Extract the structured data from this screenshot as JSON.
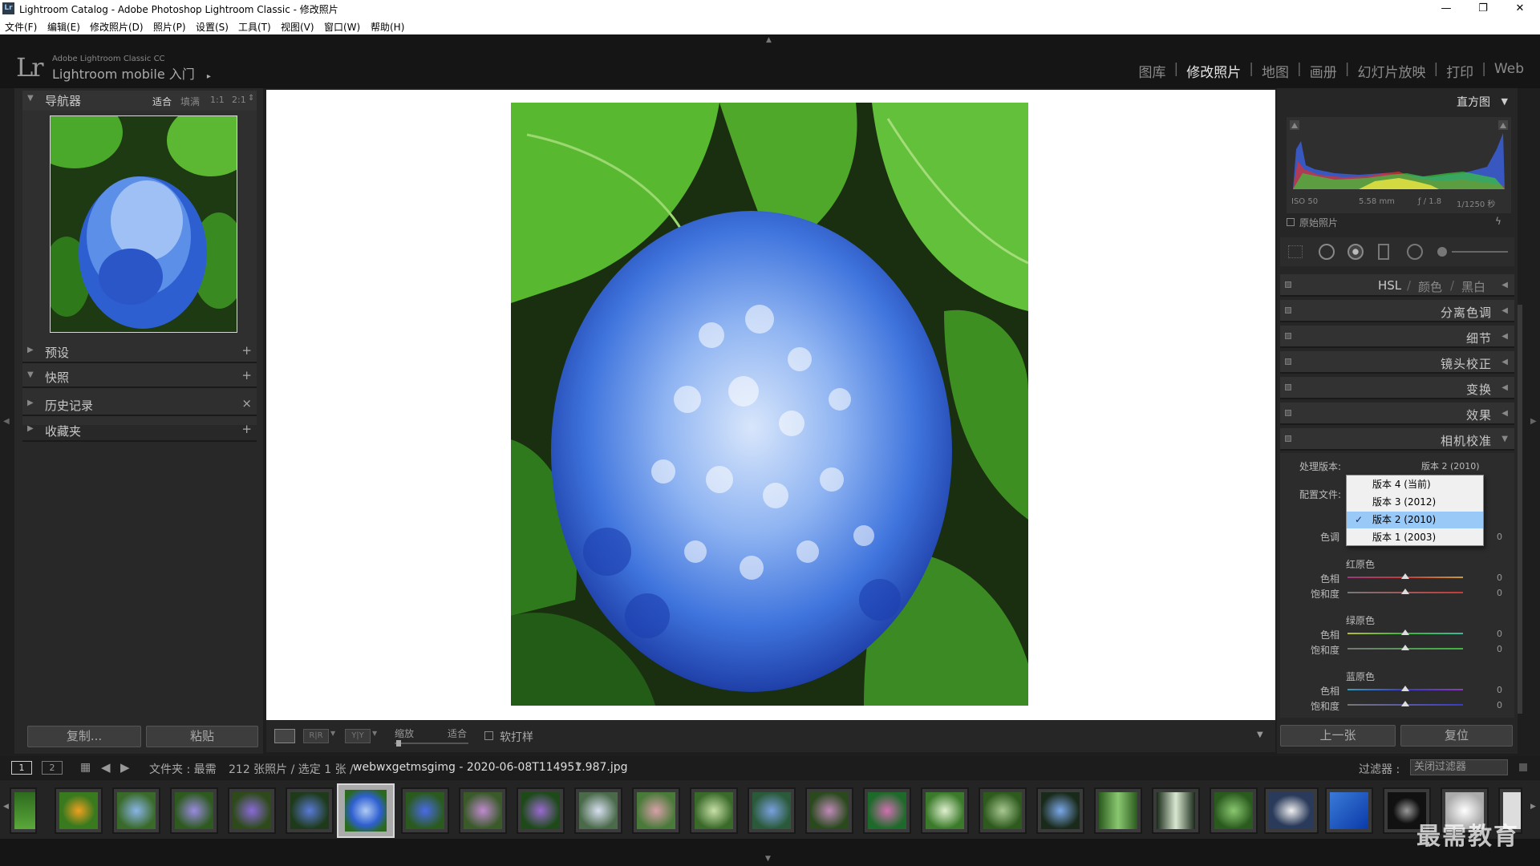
{
  "window": {
    "title": "Lightroom Catalog - Adobe Photoshop Lightroom Classic - 修改照片",
    "app_icon": "Lr",
    "minimize": "—",
    "restore": "❐",
    "close": "✕"
  },
  "menu": [
    "文件(F)",
    "编辑(E)",
    "修改照片(D)",
    "照片(P)",
    "设置(S)",
    "工具(T)",
    "视图(V)",
    "窗口(W)",
    "帮助(H)"
  ],
  "brand": {
    "logo": "Lr",
    "line1": "Adobe Lightroom Classic CC",
    "line2": "Lightroom mobile 入门",
    "arrow": "▸"
  },
  "modules": {
    "items": [
      "图库",
      "修改照片",
      "地图",
      "画册",
      "幻灯片放映",
      "打印",
      "Web"
    ],
    "active": "修改照片"
  },
  "navigator": {
    "title": "导航器",
    "zoom_fit": "适合",
    "zoom_fill": "填满",
    "zoom_1_1": "1:1",
    "zoom_2_1": "2:1"
  },
  "left_panels": [
    {
      "label": "预设",
      "action": "+",
      "expanded": false
    },
    {
      "label": "快照",
      "action": "+",
      "expanded": true
    },
    {
      "label": "历史记录",
      "action": "×",
      "expanded": false
    },
    {
      "label": "收藏夹",
      "action": "+",
      "expanded": false
    }
  ],
  "left_buttons": {
    "copy": "复制...",
    "paste": "粘贴"
  },
  "toolbar": {
    "zoom_label": "缩放",
    "fit_label": "适合",
    "softproof_label": "软打样"
  },
  "histogram": {
    "title": "直方图",
    "iso": "ISO 50",
    "focal": "5.58 mm",
    "aperture": "ƒ / 1.8",
    "shutter": "1/1250 秒",
    "original_label": "原始照片"
  },
  "right_panels": [
    {
      "label": "HSL",
      "label2": "颜色",
      "label3": "黑白",
      "collapsed": true
    },
    {
      "label": "分离色调",
      "collapsed": true
    },
    {
      "label": "细节",
      "collapsed": true
    },
    {
      "label": "镜头校正",
      "collapsed": true
    },
    {
      "label": "变换",
      "collapsed": true
    },
    {
      "label": "效果",
      "collapsed": true
    },
    {
      "label": "相机校准",
      "collapsed": false
    }
  ],
  "calibration": {
    "process_label": "处理版本:",
    "process_value": "版本 2 (2010)",
    "profile_label": "配置文件:",
    "shadows_tint_label": "色调",
    "shadows_tint_value": "0",
    "red": {
      "title": "红原色",
      "hue_label": "色相",
      "hue_value": "0",
      "sat_label": "饱和度",
      "sat_value": "0"
    },
    "green": {
      "title": "绿原色",
      "hue_label": "色相",
      "hue_value": "0",
      "sat_label": "饱和度",
      "sat_value": "0"
    },
    "blue": {
      "title": "蓝原色",
      "hue_label": "色相",
      "hue_value": "0",
      "sat_label": "饱和度",
      "sat_value": "0"
    }
  },
  "process_dropdown": {
    "options": [
      "版本 4 (当前)",
      "版本 3 (2012)",
      "版本 2 (2010)",
      "版本 1 (2003)"
    ],
    "selected": "版本 2 (2010)",
    "check": "✓"
  },
  "right_buttons": {
    "prev": "上一张",
    "reset": "复位"
  },
  "filmstrip": {
    "page1": "1",
    "page2": "2",
    "source": "文件夹 : 最需",
    "count": "212 张照片 / 选定 1 张 /",
    "filename": "webwxgetmsgimg - 2020-06-08T114951.987.jpg",
    "filter_label": "过滤器 :",
    "filter_value": "关闭过滤器",
    "selected_index": 6
  },
  "watermark": "最需教育",
  "colors": {
    "accent_selected": "#99c9f7",
    "panel_bg": "#282828",
    "active_module": "#e6e6e6"
  }
}
